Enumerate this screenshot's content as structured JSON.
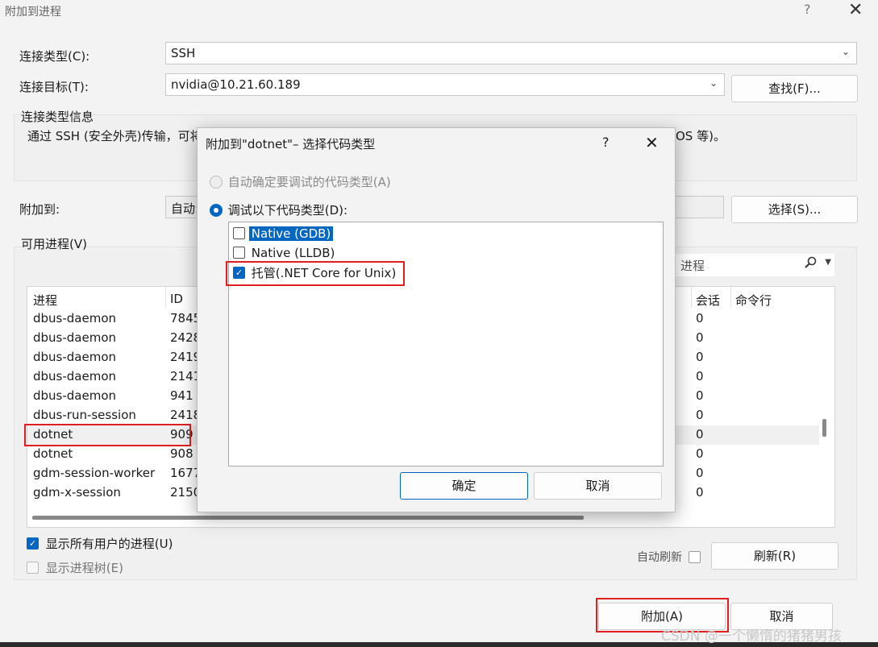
{
  "window": {
    "title": "附加到进程",
    "help": "?",
    "close": "✕"
  },
  "connection": {
    "type_label": "连接类型(C):",
    "type_value": "SSH",
    "target_label": "连接目标(T):",
    "target_value": "nvidia@10.21.60.189",
    "find_button": "查找(F)...",
    "info_title": "连接类型信息",
    "info_text_left": "通过 SSH (安全外壳)传输，可将",
    "info_text_right": "OS 等)。"
  },
  "attach_to": {
    "label": "附加到:",
    "value": "自动:",
    "select_button": "选择(S)..."
  },
  "processes": {
    "label": "可用进程(V)",
    "filter_placeholder": "进程",
    "sort_arrow": "^",
    "columns": [
      "进程",
      "ID",
      "会话",
      "命令行"
    ],
    "rows": [
      {
        "name": "dbus-daemon",
        "id": "7845",
        "session": "0"
      },
      {
        "name": "dbus-daemon",
        "id": "2428",
        "session": "0"
      },
      {
        "name": "dbus-daemon",
        "id": "2419",
        "session": "0"
      },
      {
        "name": "dbus-daemon",
        "id": "2141",
        "session": "0"
      },
      {
        "name": "dbus-daemon",
        "id": "941",
        "session": "0"
      },
      {
        "name": "dbus-run-session",
        "id": "2418",
        "session": "0"
      },
      {
        "name": "dotnet",
        "id": "909",
        "session": "0"
      },
      {
        "name": "dotnet",
        "id": "908",
        "session": "0"
      },
      {
        "name": "gdm-session-worker",
        "id": "1677",
        "session": "0"
      },
      {
        "name": "gdm-x-session",
        "id": "2150",
        "session": "0"
      }
    ],
    "show_all_users": "显示所有用户的进程(U)",
    "show_tree": "显示进程树(E)",
    "auto_refresh": "自动刷新",
    "refresh_button": "刷新(R)"
  },
  "footer": {
    "attach_button": "附加(A)",
    "cancel_button": "取消"
  },
  "dialog": {
    "title": "附加到\"dotnet\"– 选择代码类型",
    "help": "?",
    "close": "✕",
    "auto_option": "自动确定要调试的代码类型(A)",
    "manual_option": "调试以下代码类型(D):",
    "code_types": [
      {
        "label": "Native (GDB)",
        "checked": false
      },
      {
        "label": "Native (LLDB)",
        "checked": false
      },
      {
        "label": "托管(.NET Core for Unix)",
        "checked": true
      }
    ],
    "ok_button": "确定",
    "cancel_button": "取消"
  },
  "watermark": "CSDN @一个懒惰的猪猪男孩",
  "colors": {
    "accent": "#0067c0",
    "highlight_border": "#e02020",
    "selection_bg": "#0067c0"
  }
}
